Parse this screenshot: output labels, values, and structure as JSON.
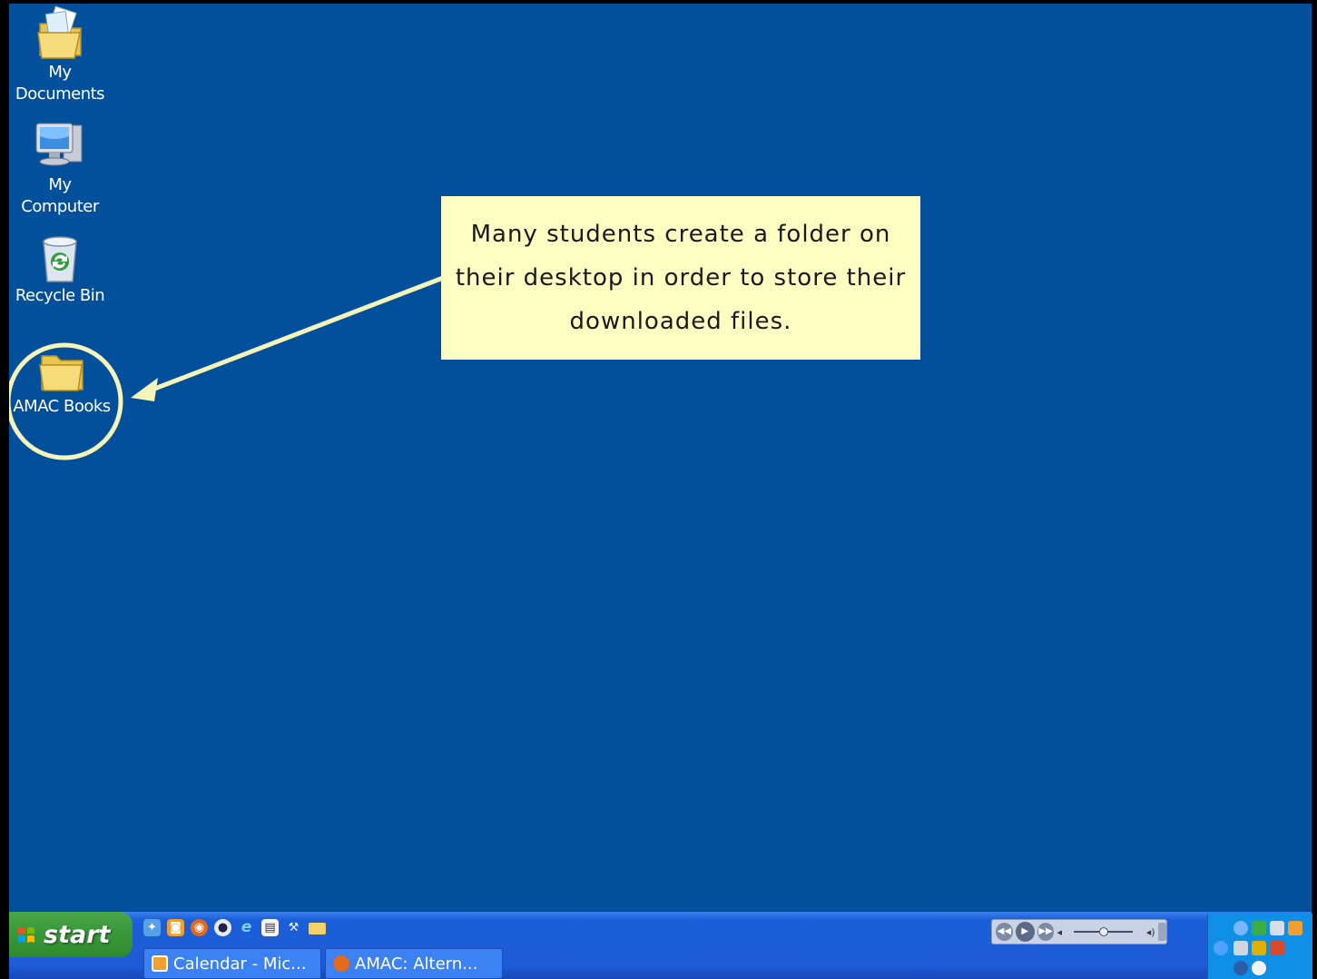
{
  "desktop": {
    "background": "#02509b",
    "icons": [
      {
        "name": "My Documents",
        "lines": [
          "My",
          "Documents"
        ],
        "icon": "folder-documents-icon"
      },
      {
        "name": "My Computer",
        "lines": [
          "My",
          "Computer"
        ],
        "icon": "computer-icon"
      },
      {
        "name": "Recycle Bin",
        "lines": [
          "Recycle Bin"
        ],
        "icon": "recycle-bin-icon"
      },
      {
        "name": "AMAC Books",
        "lines": [
          "AMAC Books"
        ],
        "icon": "folder-icon"
      }
    ]
  },
  "callout": {
    "text": "Many students create a folder on their desktop in order to store their downloaded files.",
    "background": "#ffffc4",
    "annotation_color": "#f5f5b9"
  },
  "taskbar": {
    "start_label": "start",
    "quick_launch_icons": [
      "desktop-icon",
      "calendar-icon",
      "firefox-icon",
      "media-icon",
      "ie-icon",
      "clipboard-icon",
      "tools-icon",
      "folder-icon"
    ],
    "tasks": [
      {
        "label": "Calendar - Mic...",
        "icon": "calendar-icon"
      },
      {
        "label": "AMAC: Altern...",
        "icon": "firefox-icon"
      }
    ],
    "media_player": {
      "buttons": [
        "previous-icon",
        "play-icon",
        "next-icon"
      ],
      "volume_level": 0.45
    },
    "tray_icons": [
      "network-icon",
      "security-icon",
      "display-icon",
      "calendar-icon",
      "back-arrow-icon",
      "tools-icon",
      "sound-icon",
      "alert-icon",
      "google-icon",
      "sync-icon"
    ]
  }
}
